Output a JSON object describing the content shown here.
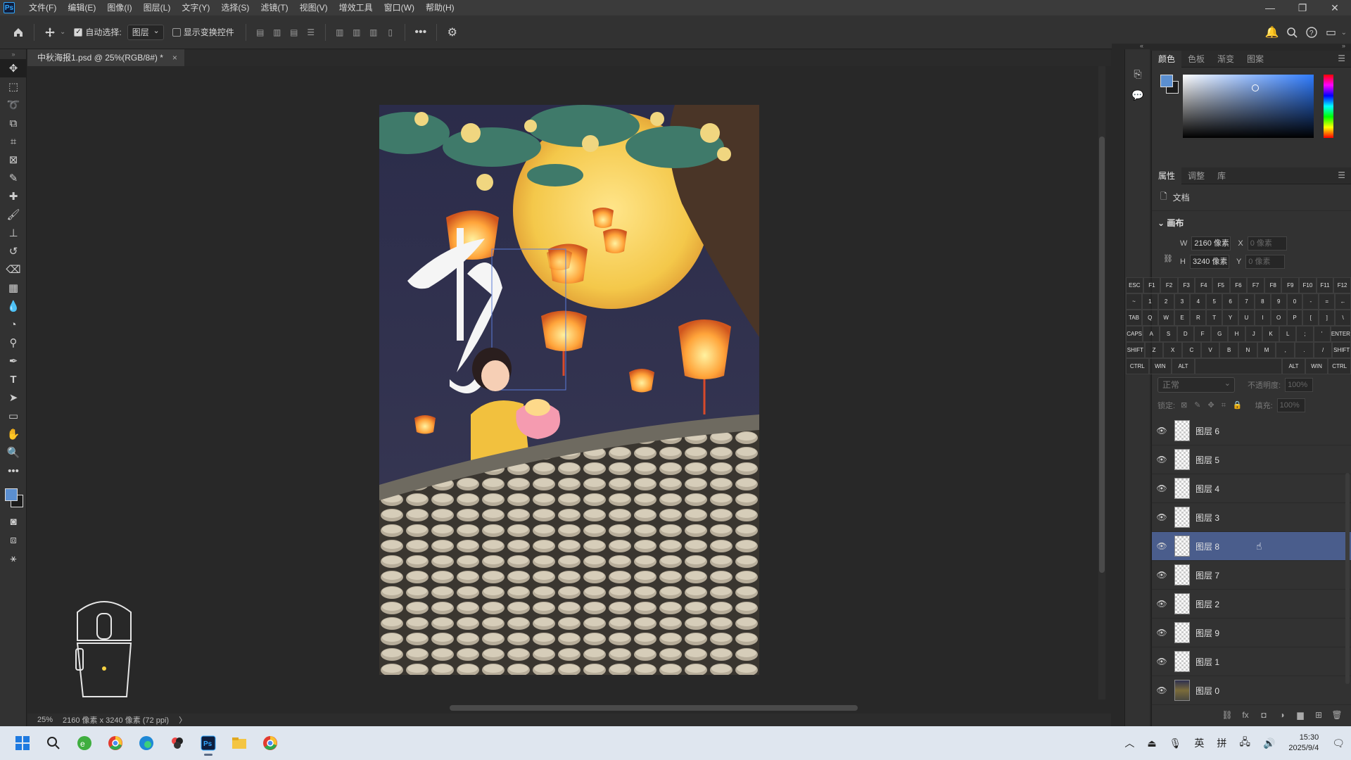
{
  "menubar": {
    "logo": "Ps",
    "items": [
      "文件(F)",
      "编辑(E)",
      "图像(I)",
      "图层(L)",
      "文字(Y)",
      "选择(S)",
      "滤镜(T)",
      "视图(V)",
      "增效工具",
      "窗口(W)",
      "帮助(H)"
    ],
    "window_controls": {
      "minimize": "—",
      "restore": "❐",
      "close": "✕"
    }
  },
  "options": {
    "auto_select_label": "自动选择:",
    "auto_select_checked": true,
    "auto_select_target": "图层",
    "show_transform_label": "显示变换控件",
    "show_transform_checked": false,
    "more": "•••"
  },
  "document": {
    "tab_title": "中秋海报1.psd @ 25%(RGB/8#) *",
    "tab_close": "×",
    "zoom": "25%",
    "size_info": "2160 像素 x 3240 像素 (72 ppi)",
    "status_arrow": "〉"
  },
  "artwork": {
    "calligraphy": "中秋"
  },
  "color_panel": {
    "tabs": [
      "颜色",
      "色板",
      "渐变",
      "图案"
    ],
    "active_tab": "颜色",
    "foreground": "#5b8fd0",
    "background": "#1b1b1b"
  },
  "properties_panel": {
    "tabs": [
      "属性",
      "调整",
      "库"
    ],
    "active_tab": "属性",
    "doc_label": "文档",
    "section_canvas": "画布",
    "w_label": "W",
    "w_value": "2160 像素",
    "h_label": "H",
    "h_value": "3240 像素",
    "x_label": "X",
    "x_value": "0 像素",
    "y_label": "Y",
    "y_value": "0 像素"
  },
  "keyboard": {
    "rows": [
      [
        "ESC",
        "F1",
        "F2",
        "F3",
        "F4",
        "F5",
        "F6",
        "F7",
        "F8",
        "F9",
        "F10",
        "F11",
        "F12"
      ],
      [
        "~",
        "1",
        "2",
        "3",
        "4",
        "5",
        "6",
        "7",
        "8",
        "9",
        "0",
        "-",
        "=",
        "←"
      ],
      [
        "TAB",
        "Q",
        "W",
        "E",
        "R",
        "T",
        "Y",
        "U",
        "I",
        "O",
        "P",
        "[",
        "]",
        "\\"
      ],
      [
        "CAPS",
        "A",
        "S",
        "D",
        "F",
        "G",
        "H",
        "J",
        "K",
        "L",
        ";",
        "'",
        "ENTER"
      ],
      [
        "SHIFT",
        "Z",
        "X",
        "C",
        "V",
        "B",
        "N",
        "M",
        ",",
        ".",
        "/",
        "SHIFT"
      ],
      [
        "CTRL",
        "WIN",
        "ALT",
        "",
        "ALT",
        "WIN",
        "CTRL"
      ]
    ]
  },
  "layers_panel": {
    "blend_mode": "正常",
    "opacity_label": "不透明度:",
    "opacity_value": "100%",
    "lock_label": "锁定:",
    "fill_label": "填充:",
    "fill_value": "100%",
    "layers": [
      {
        "name": "图层 6",
        "selected": false
      },
      {
        "name": "图层 5",
        "selected": false
      },
      {
        "name": "图层 4",
        "selected": false
      },
      {
        "name": "图层 3",
        "selected": false
      },
      {
        "name": "图层 8",
        "selected": true
      },
      {
        "name": "图层 7",
        "selected": false
      },
      {
        "name": "图层 2",
        "selected": false
      },
      {
        "name": "图层 9",
        "selected": false
      },
      {
        "name": "图层 1",
        "selected": false
      },
      {
        "name": "图层 0",
        "selected": false
      }
    ]
  },
  "taskbar": {
    "tray": {
      "input_lang": "英",
      "ime": "拼",
      "time": "15:30",
      "date": "2025/9/4"
    }
  }
}
